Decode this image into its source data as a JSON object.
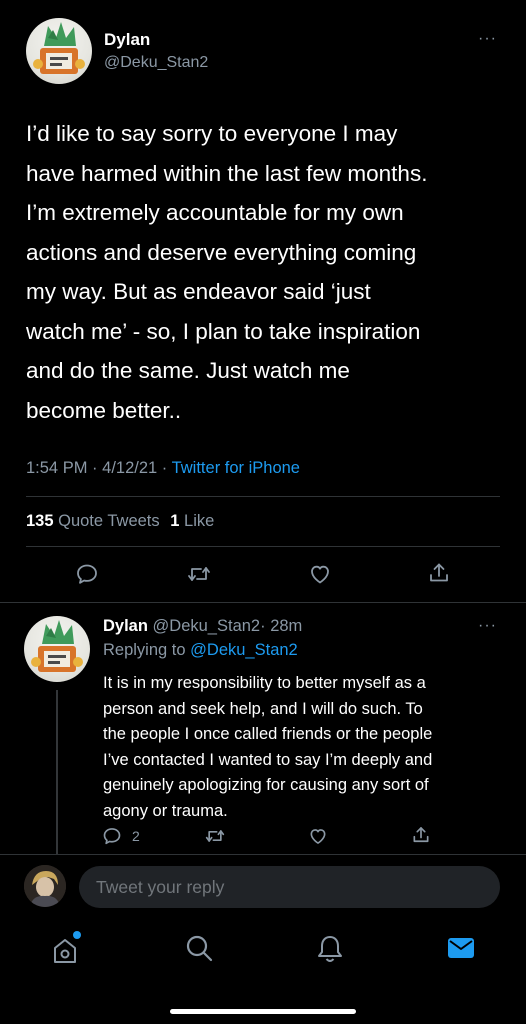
{
  "tweet": {
    "author_name": "Dylan",
    "author_handle": "@Deku_Stan2",
    "more_glyph": "···",
    "text_lines": [
      "I’d like to say sorry to everyone I may",
      "have harmed within the last few months.",
      "I’m extremely accountable for my own",
      "actions and deserve everything coming",
      "my way. But as endeavor said ‘just",
      "watch me’ - so, I plan to take inspiration",
      "and do the same. Just watch me",
      "become better.."
    ],
    "time": "1:54 PM",
    "date": "4/12/21",
    "source": "Twitter for iPhone",
    "sep": "·",
    "stats": {
      "quote_count": "135",
      "quote_label": "Quote Tweets",
      "like_count": "1",
      "like_label": "Like"
    },
    "actions": [
      "reply-icon",
      "retweet-icon",
      "like-icon",
      "share-icon"
    ]
  },
  "reply": {
    "author_name": "Dylan",
    "author_handle": "@Deku_Stan2",
    "time_ago": "· 28m",
    "replying_prefix": "Replying to",
    "replying_handle": "@Deku_Stan2",
    "more_glyph": "···",
    "text_lines": [
      "It is in my responsibility to better myself as a",
      "person and seek help, and I will do such. To",
      "the people I once called friends or the people",
      "I’ve contacted I wanted to say I’m deeply and",
      "genuinely apologizing for causing any sort of",
      "agony or trauma."
    ],
    "reply_count": "2"
  },
  "compose": {
    "placeholder": "Tweet your reply"
  },
  "tabbar": {
    "items": [
      "home-icon",
      "search-icon",
      "notifications-icon",
      "messages-icon"
    ],
    "accent": "#1d9bf0"
  }
}
